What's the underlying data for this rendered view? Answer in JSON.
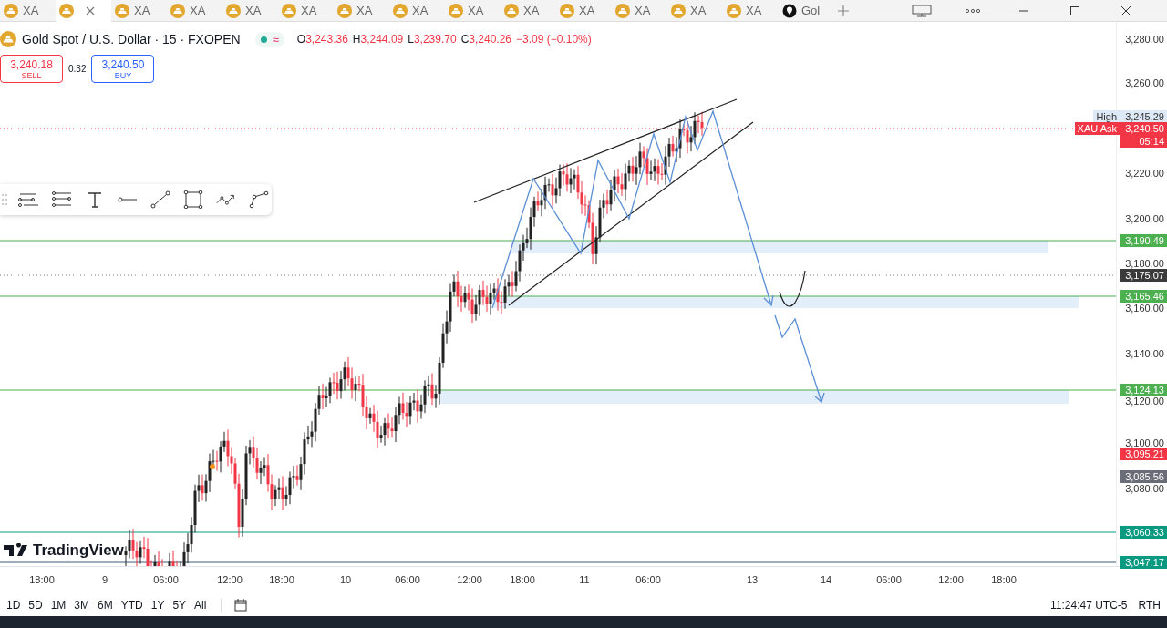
{
  "tabs": [
    {
      "label": "XA",
      "selected": false
    },
    {
      "selected": true
    },
    {
      "label": "XA",
      "selected": false
    },
    {
      "label": "XA",
      "selected": false
    },
    {
      "label": "XA",
      "selected": false
    },
    {
      "label": "XA",
      "selected": false
    },
    {
      "label": "XA",
      "selected": false
    },
    {
      "label": "XA",
      "selected": false
    },
    {
      "label": "XA",
      "selected": false
    },
    {
      "label": "XA",
      "selected": false
    },
    {
      "label": "XA",
      "selected": false
    },
    {
      "label": "XA",
      "selected": false
    },
    {
      "label": "XA",
      "selected": false
    },
    {
      "label": "XA",
      "selected": false
    },
    {
      "label": "Gol",
      "selected": false,
      "kind": "other"
    }
  ],
  "legend": {
    "title": "Gold Spot / U.S. Dollar · 15 · FXOPEN",
    "ohlc": [
      {
        "key": "O",
        "value": "3,243.36"
      },
      {
        "key": "H",
        "value": "3,244.09"
      },
      {
        "key": "L",
        "value": "3,239.70"
      },
      {
        "key": "C",
        "value": "3,240.26"
      }
    ],
    "change": "−3.09 (−0.10%)",
    "status_icon": "≈"
  },
  "trade": {
    "sell_price": "3,240.18",
    "sell_label": "SELL",
    "spread": "0.32",
    "buy_price": "3,240.50",
    "buy_label": "BUY"
  },
  "price_axis": {
    "ticks": [
      "3,280.00",
      "3,260.00",
      "3,220.00",
      "3,200.00",
      "3,180.00",
      "3,160.00",
      "3,140.00",
      "3,120.00",
      "3,100.00",
      "3,080.00"
    ],
    "tags": [
      {
        "label": "High",
        "price": "3,245.29",
        "color": "#dde9f7",
        "kind": "info"
      },
      {
        "label": "XAU Ask",
        "price": "3,240.50",
        "countdown": "05:14",
        "color": "#f23645",
        "kind": "ask"
      },
      {
        "price": "3,190.49",
        "color": "#4caf50",
        "kind": "level"
      },
      {
        "price": "3,175.07",
        "color": "#3a3a3a",
        "kind": "level"
      },
      {
        "price": "3,165.46",
        "color": "#4caf50",
        "kind": "level"
      },
      {
        "price": "3,124.13",
        "color": "#4caf50",
        "kind": "level"
      },
      {
        "price": "3,095.21",
        "color": "#f23645",
        "kind": "level"
      },
      {
        "price": "3,085.56",
        "color": "#6a6d78",
        "kind": "level"
      },
      {
        "price": "3,060.33",
        "color": "#089981",
        "kind": "level"
      },
      {
        "price": "3,047.17",
        "color": "#089981",
        "kind": "level"
      }
    ]
  },
  "time_axis": [
    "18:00",
    "9",
    "06:00",
    "12:00",
    "18:00",
    "10",
    "06:00",
    "12:00",
    "18:00",
    "11",
    "06:00",
    "13",
    "14",
    "06:00",
    "12:00",
    "18:00"
  ],
  "brand": "TradingView",
  "ranges": [
    "1D",
    "5D",
    "1M",
    "3M",
    "6M",
    "YTD",
    "1Y",
    "5Y",
    "All"
  ],
  "clock": "11:24:47 UTC-5",
  "session": "RTH"
}
